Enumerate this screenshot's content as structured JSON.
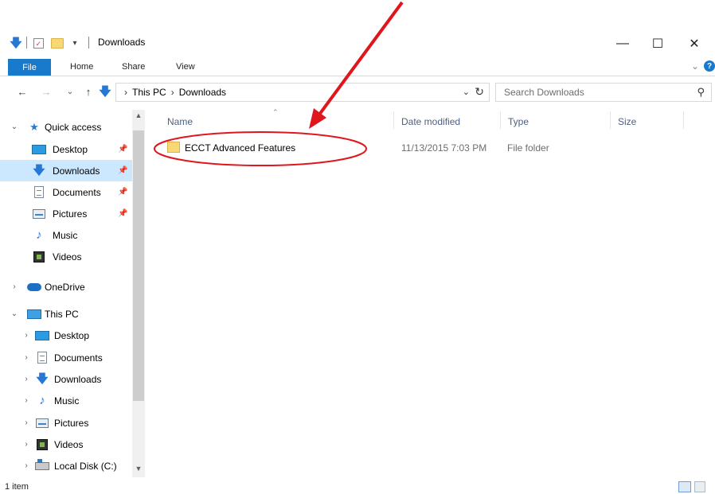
{
  "window": {
    "title": "Downloads",
    "minimize_glyph": "—",
    "maximize_glyph": "☐",
    "close_glyph": "✕"
  },
  "ribbon": {
    "tabs": [
      "File",
      "Home",
      "Share",
      "View"
    ],
    "expand_glyph": "⌄",
    "help_glyph": "?"
  },
  "address": {
    "breadcrumb": [
      "This PC",
      "Downloads"
    ],
    "separator": "›",
    "search_placeholder": "Search Downloads"
  },
  "nav": {
    "quick_access": "Quick access",
    "qa_items": [
      "Desktop",
      "Downloads",
      "Documents",
      "Pictures",
      "Music",
      "Videos"
    ],
    "onedrive": "OneDrive",
    "this_pc": "This PC",
    "pc_items": [
      "Desktop",
      "Documents",
      "Downloads",
      "Music",
      "Pictures",
      "Videos",
      "Local Disk (C:)"
    ],
    "selected": "Downloads"
  },
  "columns": {
    "name": "Name",
    "date": "Date modified",
    "type": "Type",
    "size": "Size"
  },
  "files": [
    {
      "name": "ECCT Advanced Features",
      "date": "11/13/2015 7:03 PM",
      "type": "File folder"
    }
  ],
  "status": {
    "item_count": "1 item"
  },
  "icons": {
    "quick_access": "star-icon",
    "desktop": "desktop-icon",
    "downloads": "download-arrow-icon",
    "documents": "document-icon",
    "pictures": "pictures-icon",
    "music": "music-note-icon",
    "videos": "videos-icon",
    "onedrive": "cloud-icon",
    "this_pc": "computer-icon",
    "local_disk": "disk-drive-icon",
    "folder": "folder-icon"
  },
  "colors": {
    "accent": "#1979ca",
    "selection": "#cce8ff",
    "annotation": "#e0161d"
  }
}
